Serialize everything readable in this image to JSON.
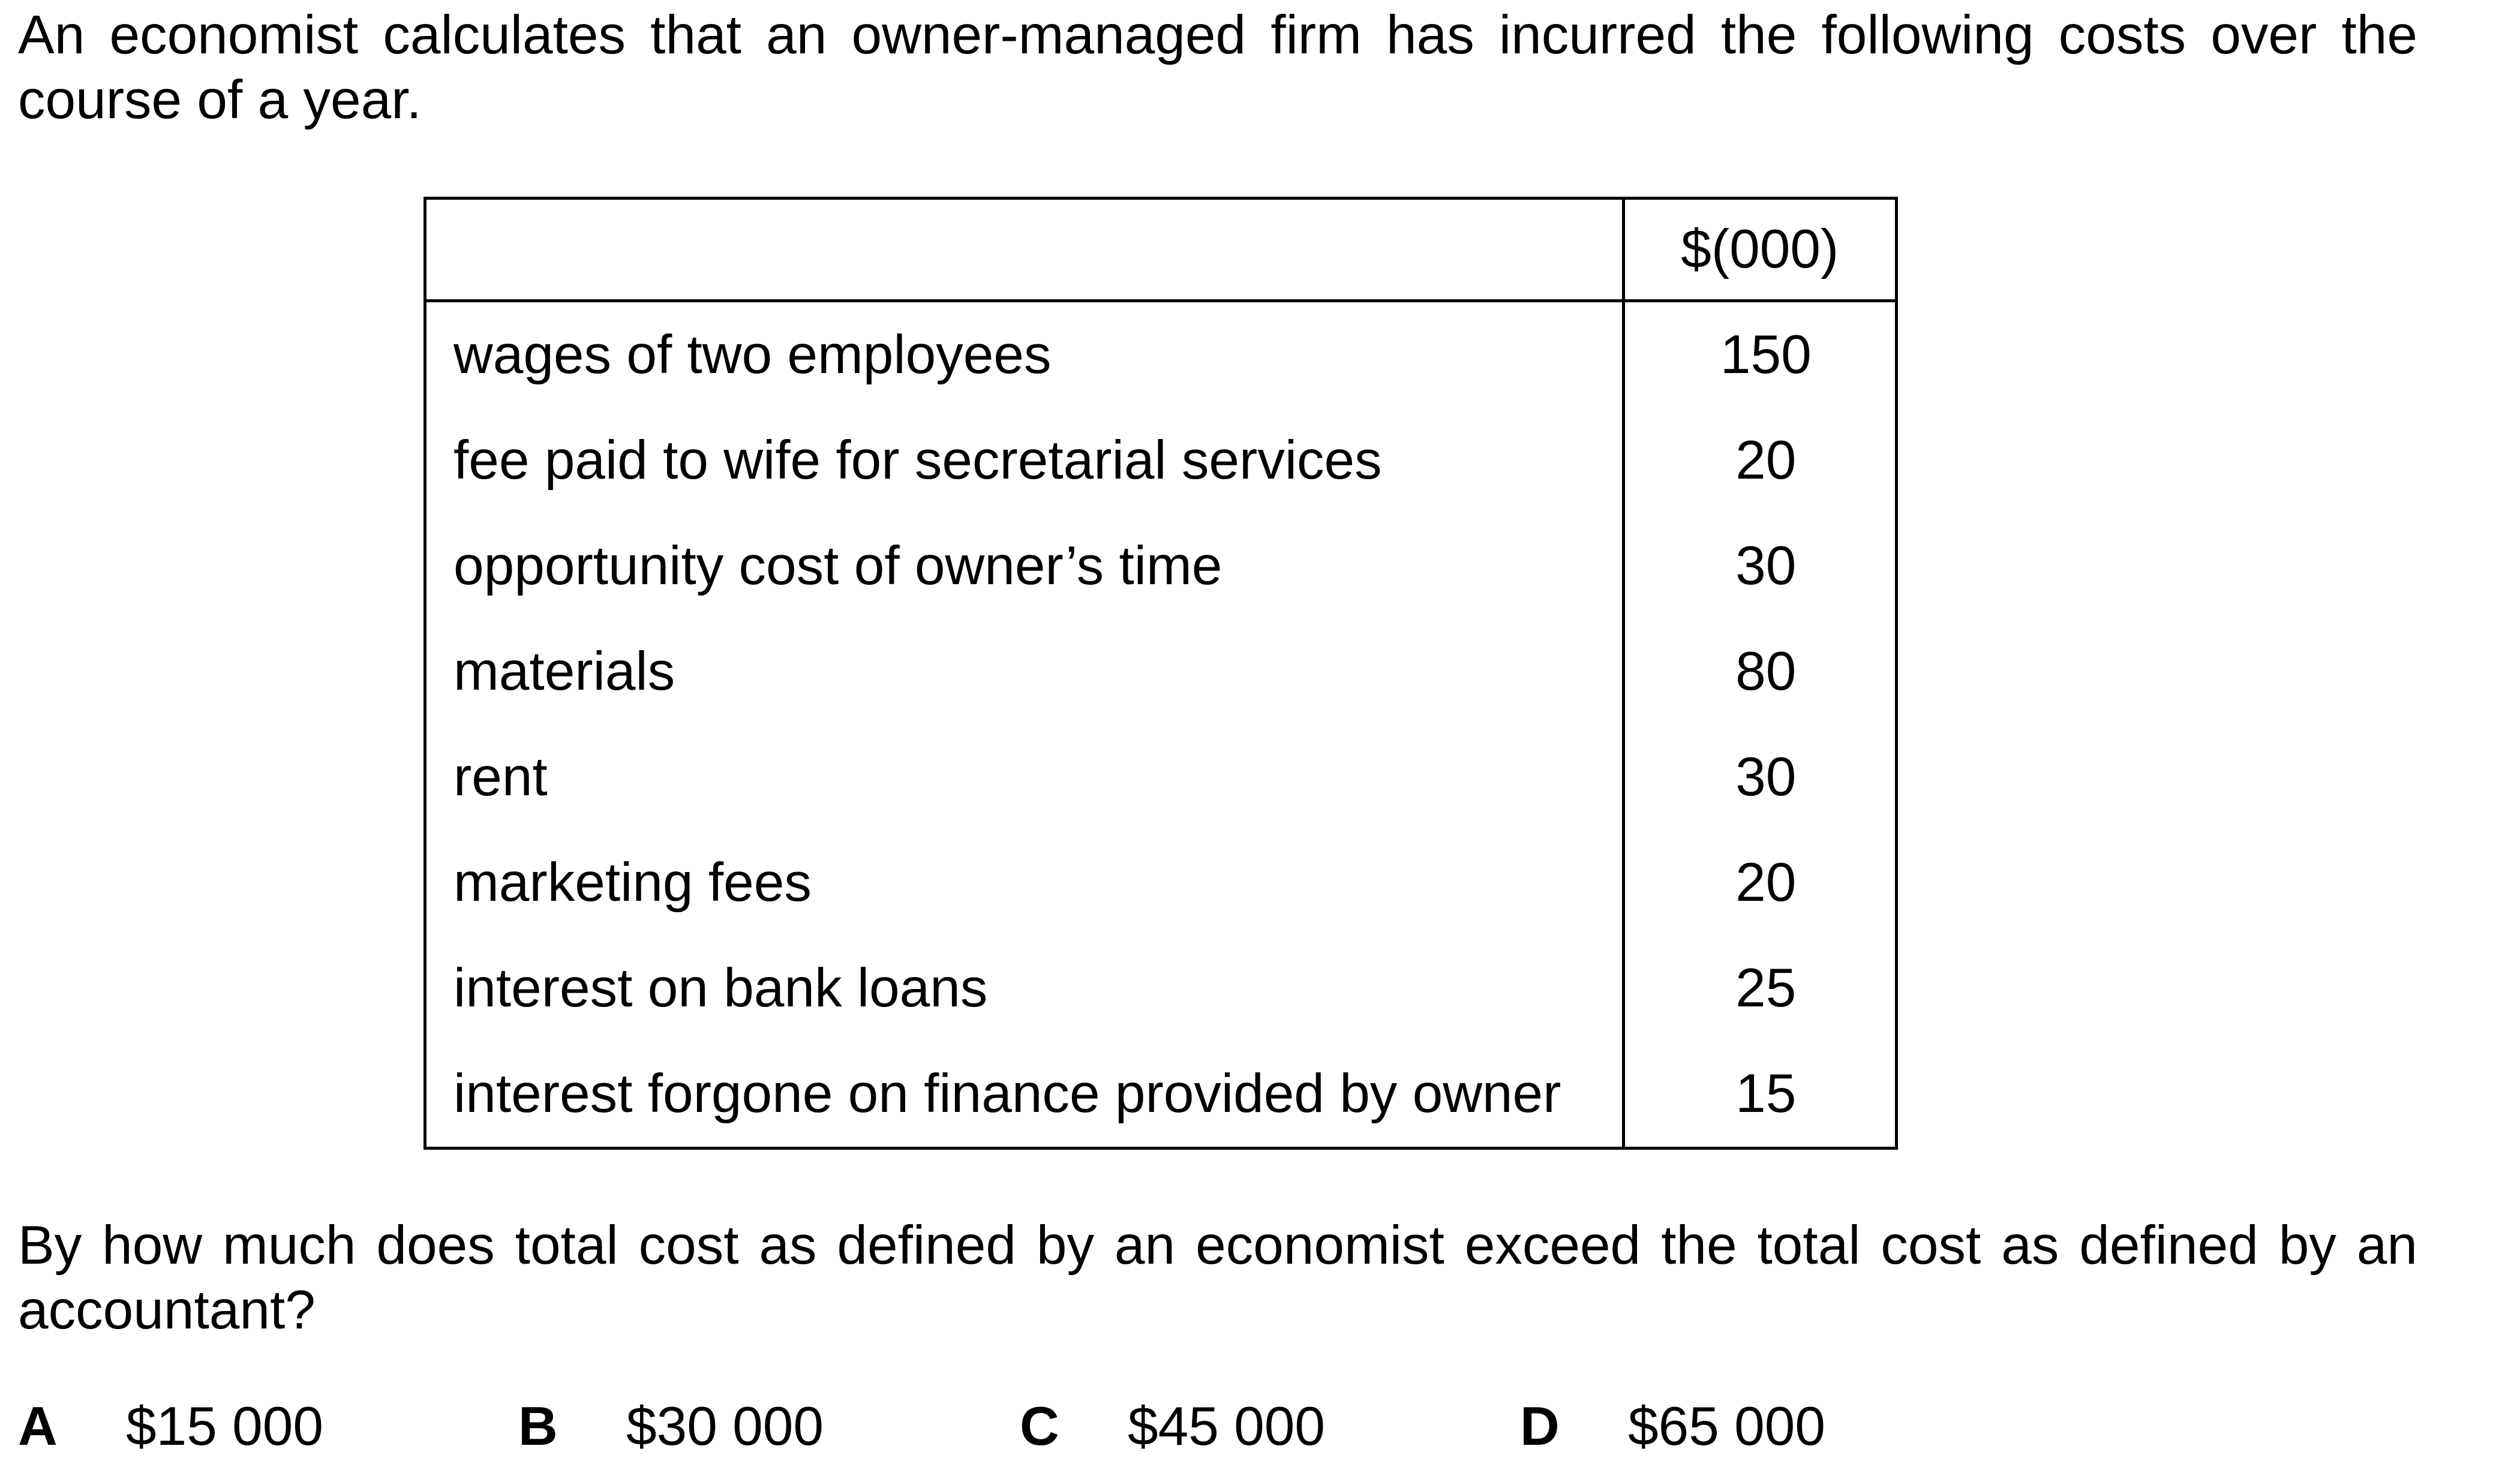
{
  "stem": "An economist calculates that an owner-managed firm has incurred the following costs over the course of a year.",
  "table": {
    "header": [
      "",
      "$(000)"
    ],
    "rows": [
      {
        "item": "wages of two employees",
        "value": "150"
      },
      {
        "item": "fee paid to wife for secretarial services",
        "value": "20"
      },
      {
        "item": "opportunity cost of owner’s time",
        "value": "30"
      },
      {
        "item": "materials",
        "value": "80"
      },
      {
        "item": "rent",
        "value": "30"
      },
      {
        "item": "marketing fees",
        "value": "20"
      },
      {
        "item": "interest on bank loans",
        "value": "25"
      },
      {
        "item": "interest forgone on finance provided by owner",
        "value": "15"
      }
    ]
  },
  "question": "By how much does total cost as defined by an economist exceed the total cost as defined by an accountant?",
  "options": [
    {
      "letter": "A",
      "text": "$15 000"
    },
    {
      "letter": "B",
      "text": "$30 000"
    },
    {
      "letter": "C",
      "text": "$45 000"
    },
    {
      "letter": "D",
      "text": "$65 000"
    }
  ]
}
